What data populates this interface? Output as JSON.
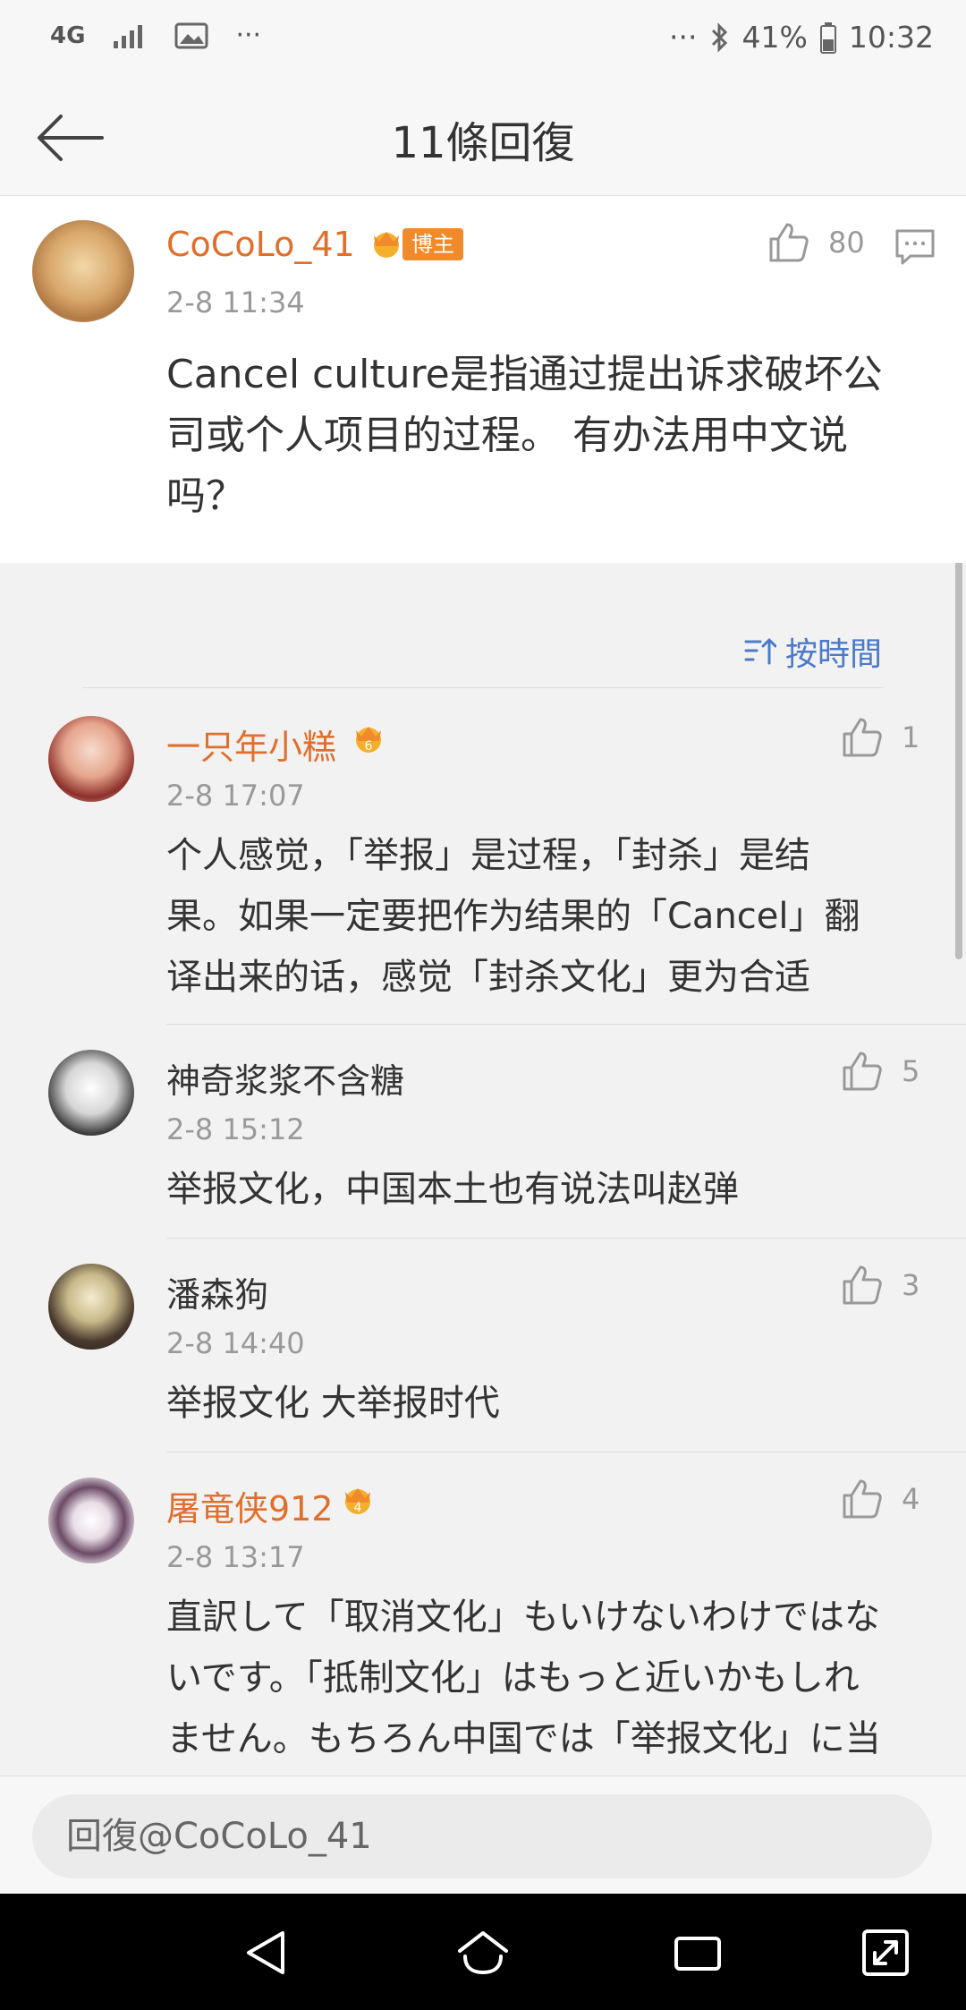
{
  "status_bar": {
    "network": "4G",
    "more": "···",
    "more_right": "···",
    "battery": "41%",
    "time": "10:32"
  },
  "header": {
    "title": "11條回復"
  },
  "main_post": {
    "username": "CoCoLo_41",
    "badge": "博主",
    "time": "2-8 11:34",
    "likes": "80",
    "text_lines": [
      "Cancel culture是指通过提出诉求破坏公",
      "司或个人项目的过程。 有办法用中文说",
      "吗？"
    ]
  },
  "sort": {
    "label": "按時間"
  },
  "replies": [
    {
      "username": "一只年小糕",
      "vip": true,
      "vip_level": "6",
      "time": "2-8 17:07",
      "likes": "1",
      "text_lines": [
        "个人感觉，「举报」是过程，「封杀」是结",
        "果。如果一定要把作为结果的「Cancel」翻",
        "译出来的话，感觉「封杀文化」更为合适"
      ]
    },
    {
      "username": "神奇浆浆不含糖",
      "vip": false,
      "time": "2-8 15:12",
      "likes": "5",
      "text_lines": [
        "举报文化，中国本土也有说法叫赵弹"
      ]
    },
    {
      "username": "潘森狗",
      "vip": false,
      "time": "2-8 14:40",
      "likes": "3",
      "text_lines": [
        "举报文化 大举报时代"
      ]
    },
    {
      "username": "屠竜侠912",
      "vip": true,
      "vip_level": "4",
      "time": "2-8 13:17",
      "likes": "4",
      "text_lines": [
        "直訳して「取消文化」もいけないわけではな",
        "いです。「抵制文化」はもっと近いかもしれ",
        "ません。もちろん中国では「举报文化」に当"
      ]
    }
  ],
  "reply_input": {
    "placeholder": "回復@CoCoLo_41"
  },
  "colors": {
    "username_orange": "#e06f2d",
    "link_blue": "#4a7ac9",
    "meta_gray": "#999999"
  }
}
